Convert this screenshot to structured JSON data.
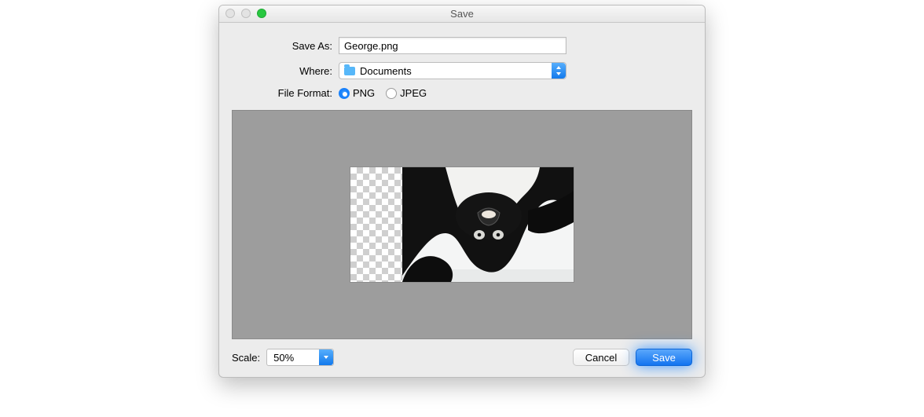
{
  "window": {
    "title": "Save"
  },
  "form": {
    "save_as_label": "Save As:",
    "filename": "George.png",
    "where_label": "Where:",
    "where_value": "Documents",
    "format_label": "File Format:",
    "format": {
      "png": "PNG",
      "jpeg": "JPEG",
      "selected": "PNG"
    }
  },
  "bottom": {
    "scale_label": "Scale:",
    "scale_value": "50%",
    "cancel": "Cancel",
    "save": "Save"
  }
}
